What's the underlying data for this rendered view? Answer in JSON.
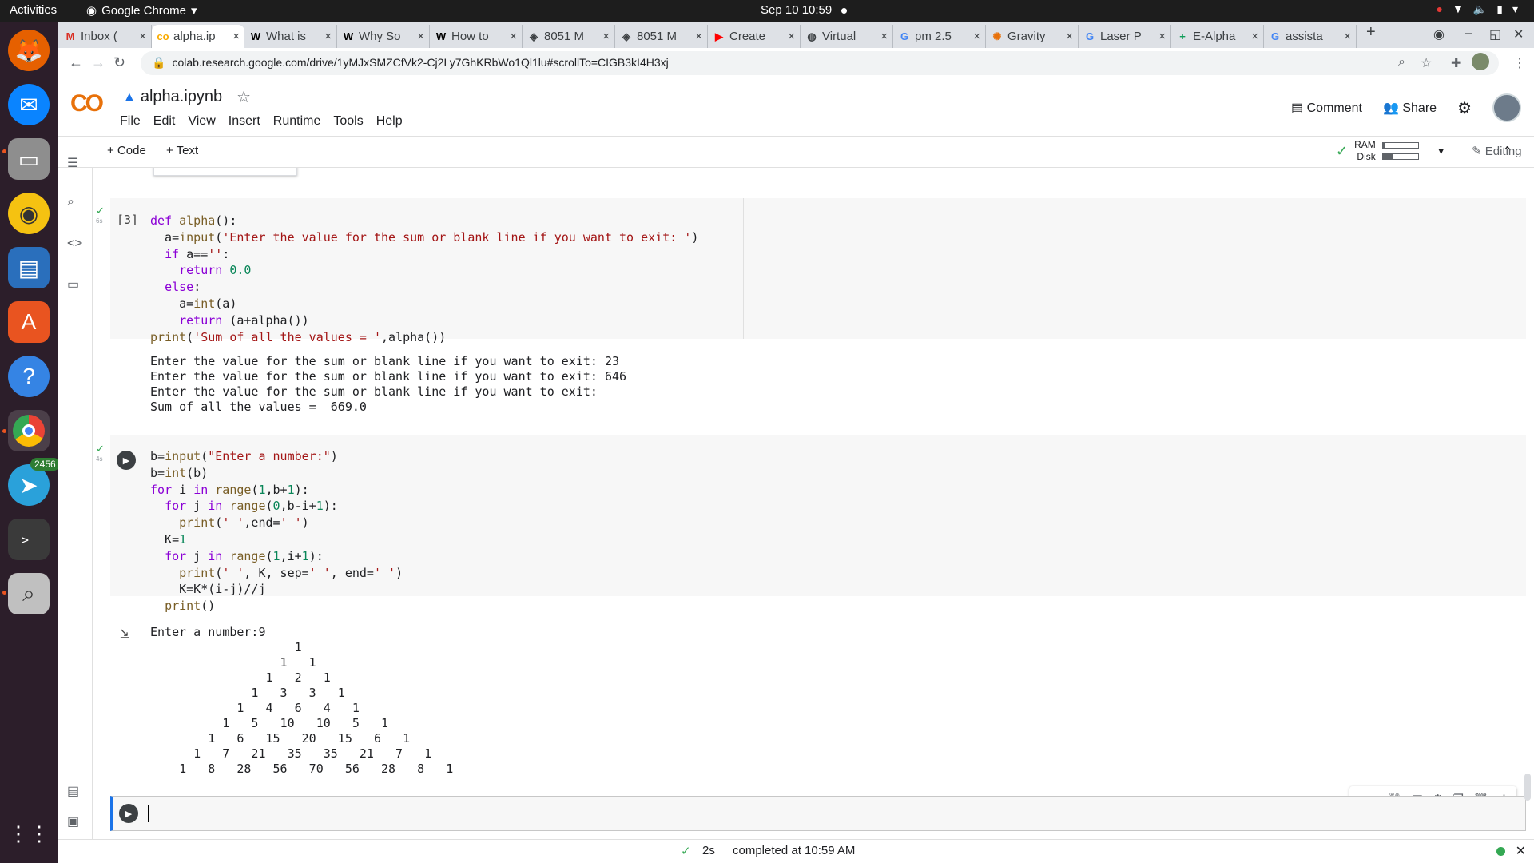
{
  "system": {
    "activities": "Activities",
    "app_name": "Google Chrome",
    "clock": "Sep 10  10:59",
    "telegram_badge": "2456"
  },
  "chrome": {
    "tabs": [
      {
        "favicon": "M",
        "label": "Inbox (",
        "color": "#d93025"
      },
      {
        "favicon": "co",
        "label": "alpha.ip",
        "color": "#f9ab00"
      },
      {
        "favicon": "W",
        "label": "What is",
        "color": "#000000"
      },
      {
        "favicon": "W",
        "label": "Why So",
        "color": "#000000"
      },
      {
        "favicon": "W",
        "label": "How to",
        "color": "#000000"
      },
      {
        "favicon": "◈",
        "label": "8051 M",
        "color": "#3c4043"
      },
      {
        "favicon": "◈",
        "label": "8051 M",
        "color": "#3c4043"
      },
      {
        "favicon": "▶",
        "label": "Create",
        "color": "#ff0000"
      },
      {
        "favicon": "◍",
        "label": "Virtual",
        "color": "#3c4043"
      },
      {
        "favicon": "G",
        "label": "pm 2.5",
        "color": "#4285f4"
      },
      {
        "favicon": "✺",
        "label": "Gravity",
        "color": "#e8710a"
      },
      {
        "favicon": "G",
        "label": "Laser P",
        "color": "#4285f4"
      },
      {
        "favicon": "+",
        "label": "E-Alpha",
        "color": "#0f9d58"
      },
      {
        "favicon": "G",
        "label": "assista",
        "color": "#4285f4"
      }
    ],
    "url": "colab.research.google.com/drive/1yMJxSMZCfVk2-Cj2Ly7GhKRbWo1Ql1lu#scrollTo=CIGB3kI4H3xj"
  },
  "colab": {
    "logo": "CO",
    "title": "alpha.ipynb",
    "menu": [
      "File",
      "Edit",
      "View",
      "Insert",
      "Runtime",
      "Tools",
      "Help"
    ],
    "comment": "Comment",
    "share": "Share",
    "add_code": "+ Code",
    "add_text": "+ Text",
    "ram_label": "RAM",
    "disk_label": "Disk",
    "ram_usage": 0.05,
    "disk_usage": 0.3,
    "editing": "Editing"
  },
  "cells": [
    {
      "exec_count": "[3]",
      "elapsed": "6s",
      "output": "Enter the value for the sum or blank line if you want to exit: 23\nEnter the value for the sum or blank line if you want to exit: 646\nEnter the value for the sum or blank line if you want to exit: \nSum of all the values =  669.0"
    },
    {
      "elapsed": "4s",
      "output": "Enter a number:9\n                    1\n                  1   1\n                1   2   1\n              1   3   3   1\n            1   4   6   4   1\n          1   5   10   10   5   1\n        1   6   15   20   15   6   1\n      1   7   21   35   35   21   7   1\n    1   8   28   56   70   56   28   8   1"
    }
  ],
  "status": {
    "time": "2s",
    "message": "completed at 10:59 AM"
  }
}
